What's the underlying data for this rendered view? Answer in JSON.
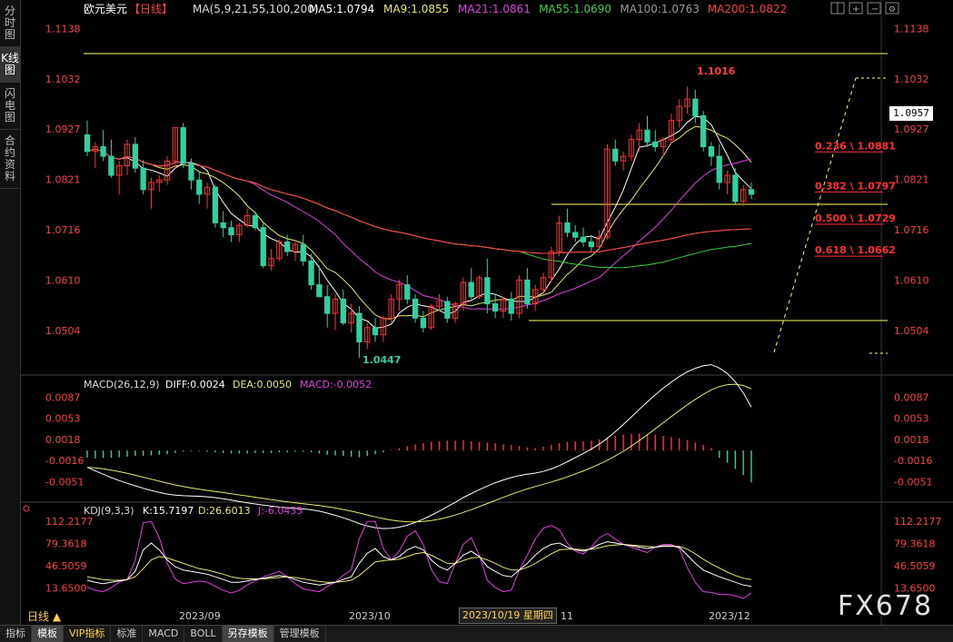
{
  "left_tabs": [
    "分时图",
    "K线图",
    "闪电图",
    "合约资料"
  ],
  "active_left_tab": 1,
  "header": {
    "symbol": "欧元美元",
    "period": "【日线】",
    "ma_params": "MA(5,9,21,55,100,200)",
    "ma_values": [
      {
        "label": "MA5:1.0794",
        "color": "#ffffff"
      },
      {
        "label": "MA9:1.0855",
        "color": "#e8e86a"
      },
      {
        "label": "MA21:1.0861",
        "color": "#e040e0"
      },
      {
        "label": "MA55:1.0690",
        "color": "#3ad23a"
      },
      {
        "label": "MA100:1.0763",
        "color": "#9a9a9a"
      },
      {
        "label": "MA200:1.0822",
        "color": "#ff4040"
      }
    ]
  },
  "toolbar_icons": [
    "grid-icon",
    "zoom-in-icon",
    "zoom-out-icon",
    "settings-icon"
  ],
  "price_axis": [
    "1.1138",
    "1.1032",
    "1.0927",
    "1.0821",
    "1.0716",
    "1.0610",
    "1.0504"
  ],
  "current_price": "1.0957",
  "high_label": "1.1016",
  "low_label": "1.0447",
  "fib_levels": [
    {
      "label": "0.236 \\ 1.0881",
      "price": 1.0881
    },
    {
      "label": "0.382 \\ 1.0797",
      "price": 1.0797
    },
    {
      "label": "0.500 \\ 1.0729",
      "price": 1.0729
    },
    {
      "label": "0.618 \\ 1.0662",
      "price": 1.0662
    }
  ],
  "macd": {
    "title": "MACD(26,12,9)",
    "diff": "DIFF:0.0024",
    "dea": "DEA:0.0050",
    "macd": "MACD:-0.0052",
    "axis": [
      "0.0087",
      "0.0053",
      "0.0018",
      "-0.0016",
      "-0.0051"
    ]
  },
  "kdj": {
    "title": "KDJ(9,3,3)",
    "k": "K:15.7197",
    "d": "D:26.6013",
    "j": "J:-6.0435",
    "axis": [
      "112.2177",
      "79.3618",
      "46.5059",
      "13.6500"
    ]
  },
  "time_axis": [
    "2023/09",
    "2023/10",
    "11",
    "2023/12"
  ],
  "cursor_date": "2023/10/19 星期四",
  "period_button": "日线 ▲",
  "bottom_tabs": [
    "指标",
    "模板",
    "VIP指标",
    "标准",
    "MACD",
    "BOLL",
    "另存模板",
    "管理模板"
  ],
  "active_bottom_tabs": [
    1,
    6
  ],
  "watermark": "FX678",
  "colors": {
    "up": "#ff3030",
    "down": "#30d0a0",
    "fib": "#ff3030",
    "guide": "#ffff66"
  },
  "chart_data": {
    "type": "candlestick",
    "ylim": [
      1.042,
      1.116
    ],
    "candles": [
      [
        1.0915,
        1.0945,
        1.087,
        1.088
      ],
      [
        1.088,
        1.09,
        1.0845,
        1.089
      ],
      [
        1.089,
        1.0925,
        1.086,
        1.087
      ],
      [
        1.087,
        1.0905,
        1.0825,
        1.083
      ],
      [
        1.083,
        1.086,
        1.079,
        1.085
      ],
      [
        1.085,
        1.0905,
        1.083,
        1.0895
      ],
      [
        1.0895,
        1.091,
        1.0835,
        1.0845
      ],
      [
        1.0845,
        1.0862,
        1.079,
        1.08
      ],
      [
        1.08,
        1.0825,
        1.076,
        1.0815
      ],
      [
        1.0815,
        1.083,
        1.0795,
        1.082
      ],
      [
        1.082,
        1.087,
        1.081,
        1.086
      ],
      [
        1.086,
        1.093,
        1.0845,
        1.093
      ],
      [
        1.093,
        1.094,
        1.0845,
        1.0855
      ],
      [
        1.0855,
        1.0865,
        1.08,
        1.082
      ],
      [
        1.082,
        1.084,
        1.077,
        1.079
      ],
      [
        1.079,
        1.0815,
        1.076,
        1.0805
      ],
      [
        1.0805,
        1.081,
        1.072,
        1.073
      ],
      [
        1.073,
        1.0755,
        1.07,
        1.072
      ],
      [
        1.072,
        1.0735,
        1.069,
        1.0705
      ],
      [
        1.0705,
        1.073,
        1.069,
        1.0725
      ],
      [
        1.0725,
        1.076,
        1.072,
        1.0745
      ],
      [
        1.0745,
        1.0755,
        1.0715,
        1.072
      ],
      [
        1.072,
        1.073,
        1.0635,
        1.064
      ],
      [
        1.064,
        1.0675,
        1.063,
        1.0655
      ],
      [
        1.0655,
        1.0695,
        1.065,
        1.069
      ],
      [
        1.069,
        1.0705,
        1.066,
        1.067
      ],
      [
        1.067,
        1.069,
        1.065,
        1.0685
      ],
      [
        1.0685,
        1.0705,
        1.064,
        1.065
      ],
      [
        1.065,
        1.0665,
        1.059,
        1.06
      ],
      [
        1.06,
        1.064,
        1.059,
        1.0575
      ],
      [
        1.0575,
        1.06,
        1.051,
        1.054
      ],
      [
        1.054,
        1.058,
        1.0505,
        1.057
      ],
      [
        1.057,
        1.059,
        1.0515,
        1.052
      ],
      [
        1.052,
        1.056,
        1.05,
        1.054
      ],
      [
        1.054,
        1.0555,
        1.0447,
        1.048
      ],
      [
        1.048,
        1.052,
        1.0465,
        1.051
      ],
      [
        1.051,
        1.053,
        1.048,
        1.0495
      ],
      [
        1.0495,
        1.0535,
        1.048,
        1.053
      ],
      [
        1.053,
        1.058,
        1.052,
        1.057
      ],
      [
        1.057,
        1.061,
        1.0545,
        1.06
      ],
      [
        1.06,
        1.062,
        1.056,
        1.057
      ],
      [
        1.057,
        1.058,
        1.052,
        1.053
      ],
      [
        1.053,
        1.0545,
        1.05,
        1.051
      ],
      [
        1.051,
        1.056,
        1.0505,
        1.0555
      ],
      [
        1.0555,
        1.058,
        1.0545,
        1.0565
      ],
      [
        1.0565,
        1.0575,
        1.052,
        1.053
      ],
      [
        1.053,
        1.0565,
        1.052,
        1.056
      ],
      [
        1.056,
        1.0615,
        1.0545,
        1.0605
      ],
      [
        1.0605,
        1.0635,
        1.057,
        1.0575
      ],
      [
        1.0575,
        1.062,
        1.057,
        1.0615
      ],
      [
        1.0615,
        1.0655,
        1.054,
        1.056
      ],
      [
        1.056,
        1.058,
        1.053,
        1.0545
      ],
      [
        1.0545,
        1.0575,
        1.053,
        1.057
      ],
      [
        1.057,
        1.0585,
        1.0525,
        1.054
      ],
      [
        1.054,
        1.062,
        1.053,
        1.061
      ],
      [
        1.061,
        1.0635,
        1.055,
        1.056
      ],
      [
        1.056,
        1.06,
        1.0545,
        1.059
      ],
      [
        1.059,
        1.0625,
        1.058,
        1.0615
      ],
      [
        1.0615,
        1.068,
        1.0605,
        1.067
      ],
      [
        1.067,
        1.0745,
        1.066,
        1.073
      ],
      [
        1.073,
        1.076,
        1.07,
        1.071
      ],
      [
        1.071,
        1.0725,
        1.069,
        1.07
      ],
      [
        1.07,
        1.072,
        1.068,
        1.069
      ],
      [
        1.069,
        1.0705,
        1.067,
        1.068
      ],
      [
        1.068,
        1.0715,
        1.0675,
        1.07
      ],
      [
        1.07,
        1.0895,
        1.0695,
        1.0885
      ],
      [
        1.0885,
        1.0905,
        1.085,
        1.086
      ],
      [
        1.086,
        1.088,
        1.084,
        1.087
      ],
      [
        1.087,
        1.0915,
        1.086,
        1.0905
      ],
      [
        1.0905,
        1.094,
        1.088,
        1.0925
      ],
      [
        1.0925,
        1.0955,
        1.089,
        1.09
      ],
      [
        1.09,
        1.0925,
        1.088,
        1.089
      ],
      [
        1.089,
        1.091,
        1.087,
        1.0905
      ],
      [
        1.0905,
        1.096,
        1.0895,
        1.0945
      ],
      [
        1.0945,
        1.099,
        1.093,
        1.0975
      ],
      [
        1.0975,
        1.1016,
        1.096,
        1.099
      ],
      [
        1.099,
        1.101,
        1.094,
        1.0955
      ],
      [
        1.0955,
        1.0965,
        1.088,
        1.089
      ],
      [
        1.089,
        1.09,
        1.085,
        1.087
      ],
      [
        1.087,
        1.0895,
        1.08,
        1.0815
      ],
      [
        1.0815,
        1.084,
        1.079,
        1.083
      ],
      [
        1.083,
        1.0845,
        1.077,
        1.0775
      ],
      [
        1.0775,
        1.081,
        1.0765,
        1.08
      ],
      [
        1.08,
        1.0815,
        1.078,
        1.079
      ]
    ],
    "macd_hist": [
      -0.0012,
      -0.0013,
      -0.0012,
      -0.0012,
      -0.0011,
      -0.001,
      -0.0009,
      -0.0009,
      -0.0008,
      -0.0007,
      -0.0006,
      -0.0004,
      -0.0002,
      -0.0001,
      -0.0001,
      -0.0002,
      -0.0003,
      -0.0004,
      -0.0005,
      -0.0005,
      -0.0005,
      -0.0004,
      -0.0004,
      -0.0004,
      -0.0003,
      -0.0003,
      -0.0002,
      -0.0002,
      -0.0003,
      -0.0005,
      -0.0007,
      -0.0008,
      -0.0009,
      -0.001,
      -0.0011,
      -0.0009,
      -0.0006,
      -0.0003,
      0.0001,
      0.0004,
      0.0007,
      0.001,
      0.0012,
      0.0014,
      0.0015,
      0.0016,
      0.0016,
      0.0017,
      0.0015,
      0.0014,
      0.0013,
      0.0012,
      0.001,
      0.0009,
      0.0007,
      0.0005,
      0.0004,
      0.0006,
      0.0009,
      0.0012,
      0.0014,
      0.0015,
      0.0015,
      0.0016,
      0.0018,
      0.0021,
      0.0024,
      0.0026,
      0.0027,
      0.0028,
      0.0027,
      0.0026,
      0.0024,
      0.0022,
      0.002,
      0.0017,
      0.0013,
      0.0009,
      0.0004,
      -0.0012,
      -0.002,
      -0.003,
      -0.004,
      -0.0052
    ],
    "kdj_k": [
      25,
      22,
      20,
      22,
      24,
      26,
      38,
      70,
      80,
      70,
      55,
      45,
      40,
      38,
      36,
      34,
      30,
      26,
      22,
      22,
      24,
      26,
      28,
      30,
      32,
      30,
      26,
      22,
      20,
      18,
      20,
      22,
      26,
      30,
      50,
      65,
      72,
      60,
      55,
      60,
      70,
      75,
      70,
      55,
      45,
      40,
      50,
      62,
      68,
      60,
      45,
      38,
      32,
      30,
      40,
      50,
      62,
      72,
      78,
      80,
      74,
      70,
      68,
      72,
      78,
      82,
      80,
      78,
      76,
      74,
      72,
      74,
      76,
      76,
      74,
      62,
      50,
      40,
      35,
      30,
      26,
      22,
      18,
      16
    ],
    "kdj_d": [
      30,
      28,
      26,
      25,
      25,
      26,
      30,
      42,
      55,
      60,
      58,
      54,
      50,
      46,
      42,
      40,
      37,
      34,
      30,
      28,
      27,
      27,
      27,
      28,
      29,
      30,
      29,
      27,
      25,
      23,
      22,
      22,
      23,
      25,
      32,
      42,
      52,
      54,
      55,
      56,
      60,
      64,
      66,
      62,
      56,
      50,
      50,
      54,
      58,
      59,
      55,
      50,
      44,
      40,
      40,
      44,
      50,
      57,
      64,
      70,
      71,
      71,
      70,
      71,
      73,
      76,
      77,
      78,
      77,
      76,
      75,
      74,
      75,
      75,
      75,
      71,
      64,
      56,
      49,
      43,
      37,
      32,
      28,
      26
    ],
    "kdj_j": [
      15,
      10,
      8,
      14,
      22,
      26,
      54,
      110,
      112,
      88,
      50,
      27,
      20,
      22,
      24,
      22,
      16,
      10,
      6,
      10,
      18,
      24,
      30,
      34,
      38,
      30,
      20,
      12,
      10,
      8,
      16,
      22,
      32,
      40,
      86,
      112,
      112,
      72,
      55,
      68,
      90,
      98,
      78,
      41,
      23,
      20,
      50,
      78,
      88,
      62,
      25,
      14,
      8,
      10,
      40,
      62,
      86,
      102,
      106,
      100,
      80,
      68,
      64,
      74,
      88,
      94,
      86,
      78,
      74,
      70,
      66,
      74,
      78,
      78,
      72,
      44,
      22,
      8,
      7,
      4,
      4,
      2,
      -2,
      6
    ]
  }
}
